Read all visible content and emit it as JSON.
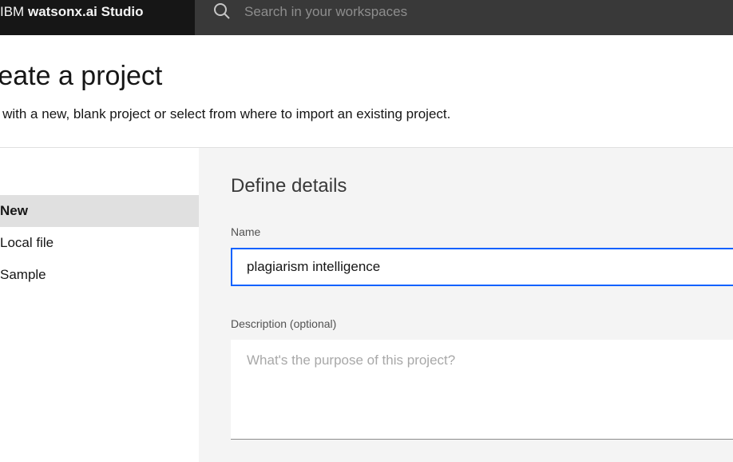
{
  "header": {
    "brand_prefix": "IBM",
    "brand_product": "watsonx.ai Studio",
    "search_placeholder": "Search in your workspaces",
    "search_icon": "search-icon"
  },
  "page": {
    "title": "reate a project",
    "subtitle": "rt with a new, blank project or select from where to import an existing project."
  },
  "nav": {
    "items": [
      {
        "label": "New",
        "active": true
      },
      {
        "label": "Local file",
        "active": false
      },
      {
        "label": "Sample",
        "active": false
      }
    ]
  },
  "form": {
    "section_title": "Define details",
    "name_label": "Name",
    "name_value": "plagiarism intelligence",
    "description_label": "Description (optional)",
    "description_placeholder": "What's the purpose of this project?"
  },
  "colors": {
    "header_bg": "#161616",
    "search_bg": "#393939",
    "focus_border": "#0f62fe",
    "panel_bg": "#f4f4f4",
    "nav_active_bg": "#e0e0e0"
  }
}
